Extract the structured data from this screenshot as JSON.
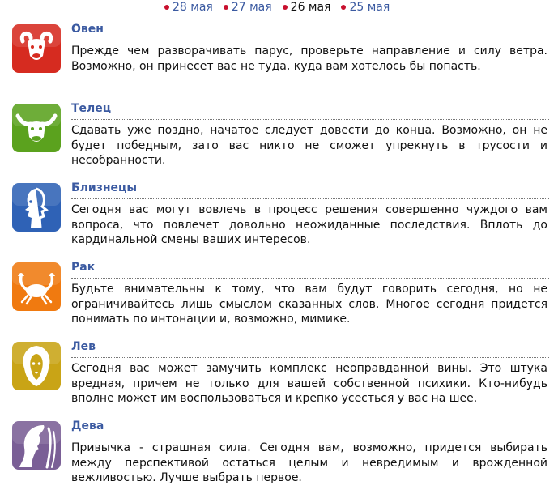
{
  "dates": [
    {
      "label": "28 мая",
      "current": false
    },
    {
      "label": "27 мая",
      "current": false
    },
    {
      "label": "26 мая",
      "current": true
    },
    {
      "label": "25 мая",
      "current": false
    }
  ],
  "signs": [
    {
      "name": "Овен",
      "icon": "aries-icon",
      "color": "#d62b20",
      "text": "Прежде чем разворачивать парус, проверьте направление и силу ветра. Возможно, он принесет вас не туда, куда вам хотелось бы попасть."
    },
    {
      "name": "Телец",
      "icon": "taurus-icon",
      "color": "#5ba21e",
      "text": "Сдавать уже поздно, начатое следует довести до конца. Возможно, он не будет победным, зато вас никто не сможет упрекнуть в трусости и несобранности."
    },
    {
      "name": "Близнецы",
      "icon": "gemini-icon",
      "color": "#2f62b6",
      "text": "Сегодня вас могут вовлечь в процесс решения совершенно чуждого вам вопроса, что повлечет довольно неожиданные последствия. Вплоть до кардинальной смены ваших интересов."
    },
    {
      "name": "Рак",
      "icon": "cancer-icon",
      "color": "#f07a10",
      "text": "Будьте внимательны к тому, что вам будут говорить сегодня, но не ограничивайтесь лишь смыслом сказанных слов. Многое сегодня придется понимать по интонации и, возможно, мимике."
    },
    {
      "name": "Лев",
      "icon": "leo-icon",
      "color": "#c9a416",
      "text": "Сегодня вас может замучить комплекс неоправданной вины. Это штука вредная, причем не только для вашей собственной психики. Кто-нибудь вполне может им воспользоваться и крепко усесться у вас на шее."
    },
    {
      "name": "Дева",
      "icon": "virgo-icon",
      "color": "#7a5f96",
      "text": "Привычка - страшная сила. Сегодня вам, возможно, придется выбирать между перспективой остаться целым и невредимым и врожденной вежливостью. Лучше выбрать первое."
    }
  ]
}
